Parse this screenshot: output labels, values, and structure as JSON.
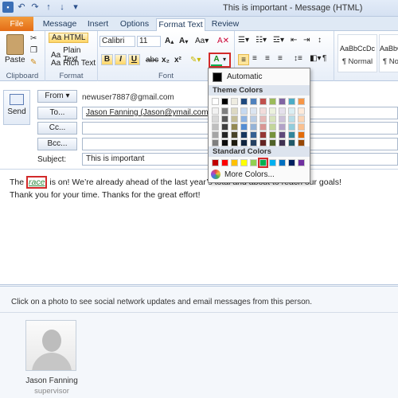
{
  "window": {
    "title": "This is important - Message (HTML)"
  },
  "tabs": [
    "File",
    "Message",
    "Insert",
    "Options",
    "Format Text",
    "Review"
  ],
  "ribbon": {
    "clipboard": {
      "paste": "Paste",
      "label": "Clipboard"
    },
    "format": {
      "html": "HTML",
      "plain": "Plain Text",
      "rich": "Rich Text",
      "label": "Format"
    },
    "font": {
      "name": "Calibri",
      "size": "11",
      "label": "Font"
    },
    "styles": [
      {
        "sample": "AaBbCcDc",
        "name": "¶ Normal"
      },
      {
        "sample": "AaBbCcDc",
        "name": "¶ No"
      }
    ]
  },
  "header": {
    "send": "Send",
    "from_button": "From",
    "from_value": "newuser7887@gmail.com",
    "to_button": "To...",
    "to_value": "Jason Fanning (Jason@ymail.com);",
    "cc_button": "Cc...",
    "bcc_button": "Bcc...",
    "subject_label": "Subject:",
    "subject_value": "This is important"
  },
  "body": {
    "line1_prefix": "The ",
    "line1_race": "race",
    "line1_rest": " is on! We’re already ahead of the last year’s total and about to reach our goals!",
    "line2": "Thank you for your time. Thanks for the great effort!"
  },
  "color_menu": {
    "automatic": "Automatic",
    "theme_title": "Theme Colors",
    "standard_title": "Standard Colors",
    "more": "More Colors...",
    "theme_top": [
      "#ffffff",
      "#000000",
      "#eeece1",
      "#1f497d",
      "#4f81bd",
      "#c0504d",
      "#9bbb59",
      "#8064a2",
      "#4bacc6",
      "#f79646"
    ],
    "theme_shades": [
      [
        "#f2f2f2",
        "#808080",
        "#ddd9c3",
        "#c6d9f0",
        "#dbe5f1",
        "#f2dcdb",
        "#ebf1dd",
        "#e5e0ec",
        "#dbeef3",
        "#fdeada"
      ],
      [
        "#d8d8d8",
        "#595959",
        "#c4bd97",
        "#8db3e2",
        "#b8cce4",
        "#e5b9b7",
        "#d7e3bc",
        "#ccc1d9",
        "#b7dde8",
        "#fbd5b5"
      ],
      [
        "#bfbfbf",
        "#3f3f3f",
        "#938953",
        "#548dd4",
        "#95b3d7",
        "#d99694",
        "#c3d69b",
        "#b2a2c7",
        "#92cddc",
        "#fac08f"
      ],
      [
        "#a5a5a5",
        "#262626",
        "#494429",
        "#17365d",
        "#366092",
        "#953734",
        "#76923c",
        "#5f497a",
        "#31859b",
        "#e36c09"
      ],
      [
        "#7f7f7f",
        "#0c0c0c",
        "#1d1b10",
        "#0f243e",
        "#244061",
        "#632423",
        "#4f6128",
        "#3f3151",
        "#205867",
        "#974806"
      ]
    ],
    "standard": [
      "#c00000",
      "#ff0000",
      "#ffc000",
      "#ffff00",
      "#92d050",
      "#00b050",
      "#00b0f0",
      "#0070c0",
      "#002060",
      "#7030a0"
    ],
    "selected_standard_index": 5
  },
  "social": {
    "hint": "Click on a photo to see social network updates and email messages from this person.",
    "person_name": "Jason Fanning",
    "person_role": "supervisor"
  }
}
